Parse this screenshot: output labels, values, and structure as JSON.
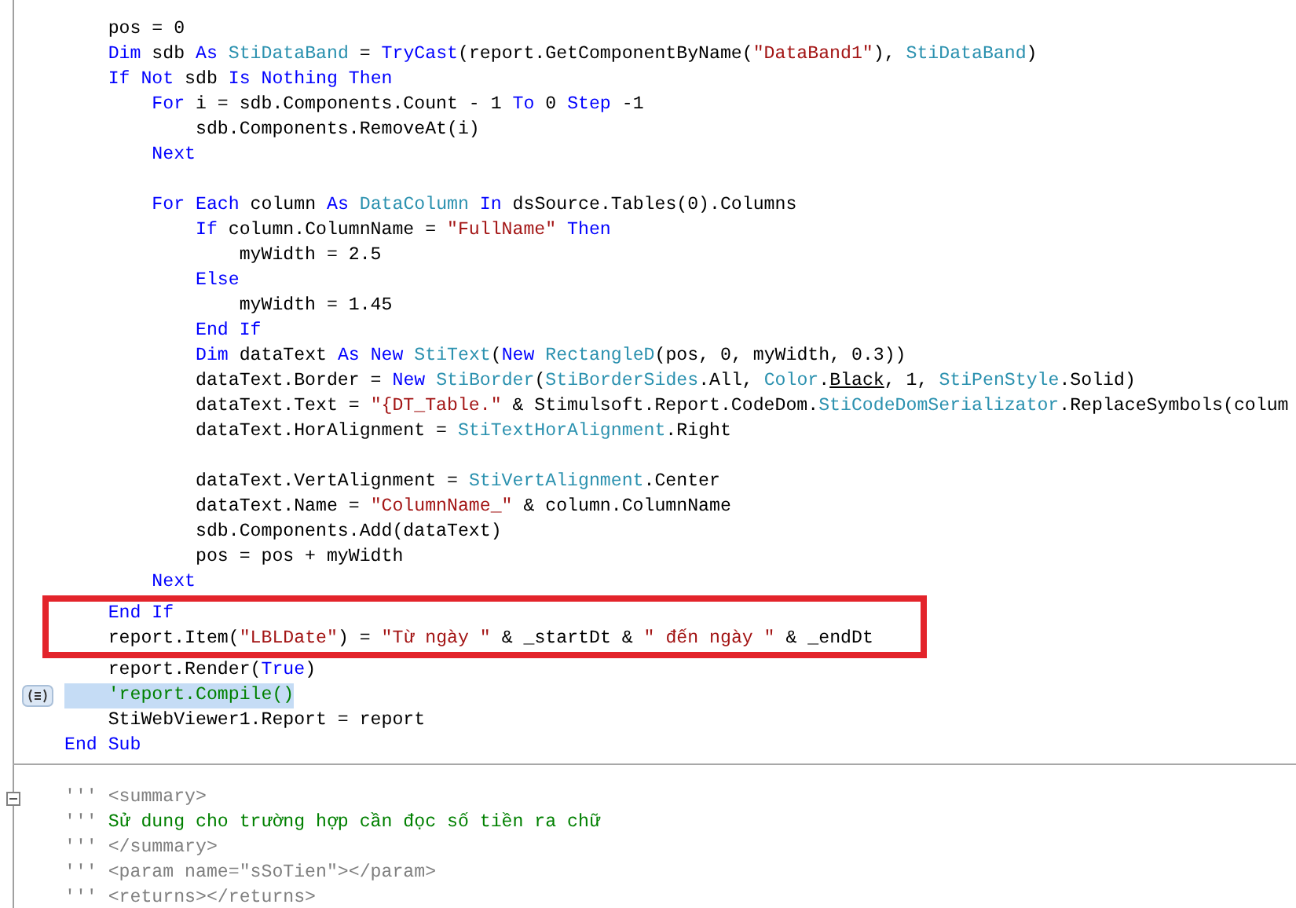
{
  "editor": {
    "blocks": [
      {
        "foldable": false,
        "lines": [
          {
            "selected": false,
            "boxed": false,
            "tokens": [
              {
                "kind": "plain",
                "text": "    pos = 0"
              }
            ]
          },
          {
            "selected": false,
            "boxed": false,
            "tokens": [
              {
                "kind": "keyword",
                "text": "    Dim"
              },
              {
                "kind": "plain",
                "text": " sdb "
              },
              {
                "kind": "keyword",
                "text": "As "
              },
              {
                "kind": "type",
                "text": "StiDataBand"
              },
              {
                "kind": "plain",
                "text": " = "
              },
              {
                "kind": "keyword",
                "text": "TryCast"
              },
              {
                "kind": "plain",
                "text": "(report.GetComponentByName("
              },
              {
                "kind": "string",
                "text": "\"DataBand1\""
              },
              {
                "kind": "plain",
                "text": "), "
              },
              {
                "kind": "type",
                "text": "StiDataBand"
              },
              {
                "kind": "plain",
                "text": ")"
              }
            ]
          },
          {
            "selected": false,
            "boxed": false,
            "tokens": [
              {
                "kind": "keyword",
                "text": "    If Not"
              },
              {
                "kind": "plain",
                "text": " sdb "
              },
              {
                "kind": "keyword",
                "text": "Is Nothing Then"
              }
            ]
          },
          {
            "selected": false,
            "boxed": false,
            "tokens": [
              {
                "kind": "keyword",
                "text": "        For"
              },
              {
                "kind": "plain",
                "text": " i = sdb.Components.Count - 1 "
              },
              {
                "kind": "keyword",
                "text": "To"
              },
              {
                "kind": "plain",
                "text": " 0 "
              },
              {
                "kind": "keyword",
                "text": "Step"
              },
              {
                "kind": "plain",
                "text": " -1"
              }
            ]
          },
          {
            "selected": false,
            "boxed": false,
            "tokens": [
              {
                "kind": "plain",
                "text": "            sdb.Components.RemoveAt(i)"
              }
            ]
          },
          {
            "selected": false,
            "boxed": false,
            "tokens": [
              {
                "kind": "keyword",
                "text": "        Next"
              }
            ]
          },
          {
            "selected": false,
            "boxed": false
          },
          {
            "selected": false,
            "boxed": false,
            "tokens": [
              {
                "kind": "keyword",
                "text": "        For Each"
              },
              {
                "kind": "plain",
                "text": " column "
              },
              {
                "kind": "keyword",
                "text": "As "
              },
              {
                "kind": "type",
                "text": "DataColumn"
              },
              {
                "kind": "keyword",
                "text": " In"
              },
              {
                "kind": "plain",
                "text": " dsSource.Tables(0).Columns"
              }
            ]
          },
          {
            "selected": false,
            "boxed": false,
            "tokens": [
              {
                "kind": "keyword",
                "text": "            If"
              },
              {
                "kind": "plain",
                "text": " column.ColumnName = "
              },
              {
                "kind": "string",
                "text": "\"FullName\""
              },
              {
                "kind": "keyword",
                "text": " Then"
              }
            ]
          },
          {
            "selected": false,
            "boxed": false,
            "tokens": [
              {
                "kind": "plain",
                "text": "                myWidth = 2.5"
              }
            ]
          },
          {
            "selected": false,
            "boxed": false,
            "tokens": [
              {
                "kind": "keyword",
                "text": "            Else"
              }
            ]
          },
          {
            "selected": false,
            "boxed": false,
            "tokens": [
              {
                "kind": "plain",
                "text": "                myWidth = 1.45"
              }
            ]
          },
          {
            "selected": false,
            "boxed": false,
            "tokens": [
              {
                "kind": "keyword",
                "text": "            End If"
              }
            ]
          },
          {
            "selected": false,
            "boxed": false,
            "tokens": [
              {
                "kind": "keyword",
                "text": "            Dim"
              },
              {
                "kind": "plain",
                "text": " dataText "
              },
              {
                "kind": "keyword",
                "text": "As New "
              },
              {
                "kind": "type",
                "text": "StiText"
              },
              {
                "kind": "plain",
                "text": "("
              },
              {
                "kind": "keyword",
                "text": "New "
              },
              {
                "kind": "type",
                "text": "RectangleD"
              },
              {
                "kind": "plain",
                "text": "(pos, 0, myWidth, 0.3))"
              }
            ]
          },
          {
            "selected": false,
            "boxed": false,
            "tokens": [
              {
                "kind": "plain",
                "text": "            dataText.Border = "
              },
              {
                "kind": "keyword",
                "text": "New "
              },
              {
                "kind": "type",
                "text": "StiBorder"
              },
              {
                "kind": "plain",
                "text": "("
              },
              {
                "kind": "type",
                "text": "StiBorderSides"
              },
              {
                "kind": "plain",
                "text": ".All, "
              },
              {
                "kind": "type",
                "text": "Color"
              },
              {
                "kind": "plain",
                "text": "."
              },
              {
                "kind": "underlined",
                "text": "Black"
              },
              {
                "kind": "plain",
                "text": ", 1, "
              },
              {
                "kind": "type",
                "text": "StiPenStyle"
              },
              {
                "kind": "plain",
                "text": ".Solid)"
              }
            ]
          },
          {
            "selected": false,
            "boxed": false,
            "tokens": [
              {
                "kind": "plain",
                "text": "            dataText.Text = "
              },
              {
                "kind": "string",
                "text": "\"{DT_Table.\""
              },
              {
                "kind": "plain",
                "text": " & Stimulsoft.Report.CodeDom."
              },
              {
                "kind": "type",
                "text": "StiCodeDomSerializator"
              },
              {
                "kind": "plain",
                "text": ".ReplaceSymbols(colum"
              }
            ]
          },
          {
            "selected": false,
            "boxed": false,
            "tokens": [
              {
                "kind": "plain",
                "text": "            dataText.HorAlignment = "
              },
              {
                "kind": "type",
                "text": "StiTextHorAlignment"
              },
              {
                "kind": "plain",
                "text": ".Right"
              }
            ]
          },
          {
            "selected": false,
            "boxed": false
          },
          {
            "selected": false,
            "boxed": false,
            "tokens": [
              {
                "kind": "plain",
                "text": "            dataText.VertAlignment = "
              },
              {
                "kind": "type",
                "text": "StiVertAlignment"
              },
              {
                "kind": "plain",
                "text": ".Center"
              }
            ]
          },
          {
            "selected": false,
            "boxed": false,
            "tokens": [
              {
                "kind": "plain",
                "text": "            dataText.Name = "
              },
              {
                "kind": "string",
                "text": "\"ColumnName_\""
              },
              {
                "kind": "plain",
                "text": " & column.ColumnName"
              }
            ]
          },
          {
            "selected": false,
            "boxed": false,
            "tokens": [
              {
                "kind": "plain",
                "text": "            sdb.Components.Add(dataText)"
              }
            ]
          },
          {
            "selected": false,
            "boxed": false,
            "tokens": [
              {
                "kind": "plain",
                "text": "            pos = pos + myWidth"
              }
            ]
          },
          {
            "selected": false,
            "boxed": false,
            "tokens": [
              {
                "kind": "keyword",
                "text": "        Next"
              }
            ]
          },
          {
            "selected": false,
            "boxed": true,
            "tokens": [
              {
                "kind": "keyword",
                "text": "    End If"
              }
            ]
          },
          {
            "selected": false,
            "boxed": true,
            "tokens": [
              {
                "kind": "plain",
                "text": "    report.Item("
              },
              {
                "kind": "string",
                "text": "\"LBLDate\""
              },
              {
                "kind": "plain",
                "text": ") = "
              },
              {
                "kind": "string",
                "text": "\"Từ ngày \""
              },
              {
                "kind": "plain",
                "text": " & _startDt & "
              },
              {
                "kind": "string",
                "text": "\" đến ngày \""
              },
              {
                "kind": "plain",
                "text": " & _endDt"
              }
            ]
          },
          {
            "selected": false,
            "boxed": false,
            "tokens": [
              {
                "kind": "plain",
                "text": "    report.Render("
              },
              {
                "kind": "keyword",
                "text": "True"
              },
              {
                "kind": "plain",
                "text": ")"
              }
            ]
          },
          {
            "selected": true,
            "boxed": false,
            "tokens": [
              {
                "kind": "comment",
                "text": "    'report.Compile()"
              }
            ]
          },
          {
            "selected": false,
            "boxed": false,
            "tokens": [
              {
                "kind": "plain",
                "text": "    StiWebViewer1.Report = report"
              }
            ]
          },
          {
            "selected": false,
            "boxed": false,
            "tokens": [
              {
                "kind": "keyword",
                "text": "End Sub"
              }
            ]
          }
        ]
      },
      {
        "foldable": true,
        "lines": [
          {
            "selected": false,
            "boxed": false,
            "tokens": [
              {
                "kind": "doc",
                "text": "''' <summary>"
              }
            ]
          },
          {
            "selected": false,
            "boxed": false,
            "tokens": [
              {
                "kind": "doc",
                "text": "'''"
              },
              {
                "kind": "comment",
                "text": " Sử dung cho trường hợp cần đọc số tiền ra chữ"
              }
            ]
          },
          {
            "selected": false,
            "boxed": false,
            "tokens": [
              {
                "kind": "doc",
                "text": "''' </summary>"
              }
            ]
          },
          {
            "selected": false,
            "boxed": false,
            "tokens": [
              {
                "kind": "doc",
                "text": "''' <param name=\"sSoTien\"></param>"
              }
            ]
          },
          {
            "selected": false,
            "boxed": false,
            "tokens": [
              {
                "kind": "doc",
                "text": "''' <returns></returns>"
              }
            ]
          }
        ]
      }
    ]
  }
}
